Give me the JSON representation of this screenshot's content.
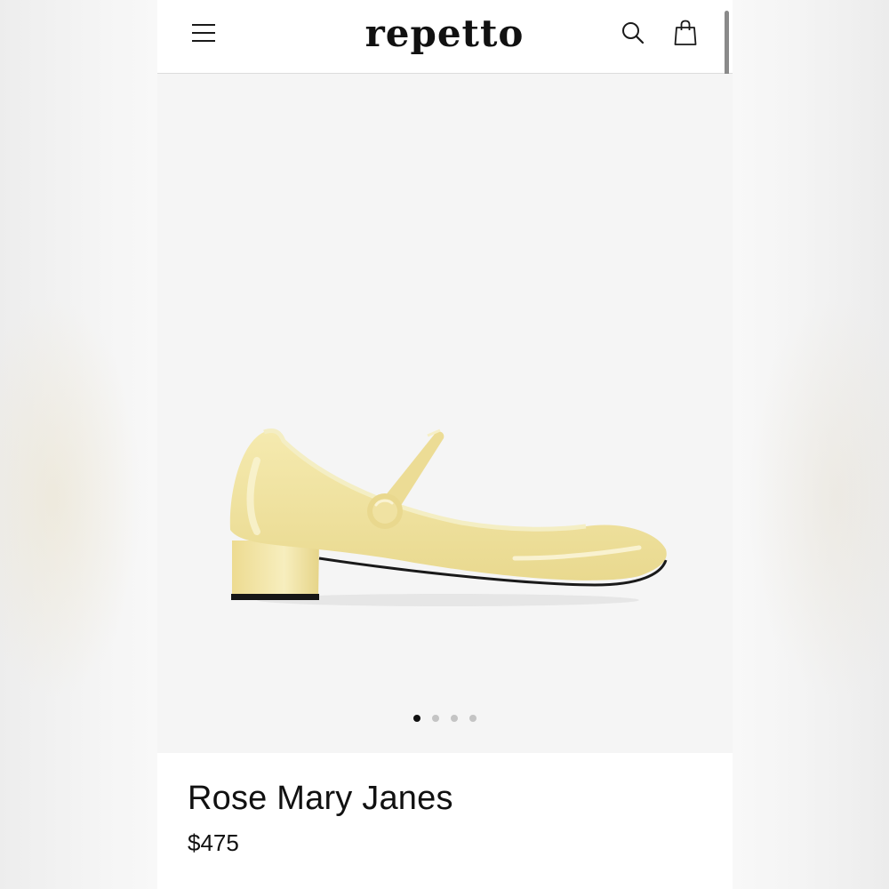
{
  "header": {
    "logo_text": "repetto",
    "menu_icon": "hamburger-menu-icon",
    "search_icon": "search-icon",
    "cart_icon": "shopping-bag-icon"
  },
  "gallery": {
    "image_count": 4,
    "active_index": 0
  },
  "product": {
    "name": "Rose Mary Janes",
    "price": "$475"
  },
  "colors": {
    "shoe": "#f3e6a6",
    "accent": "#111111",
    "gallery_background": "#f5f5f5"
  }
}
